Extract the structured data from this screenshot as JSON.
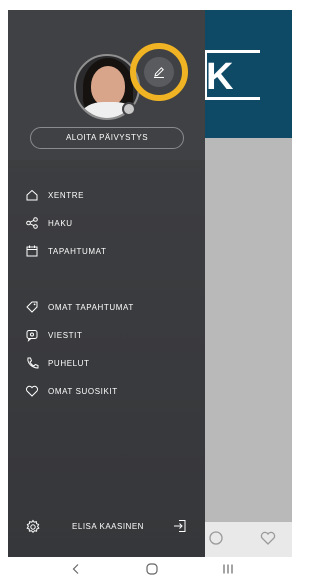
{
  "profile": {
    "shift_button_label": "ALOITA PÄIVYSTYS",
    "status": "offline"
  },
  "menu": {
    "primary": [
      {
        "label": "XENTRE",
        "icon": "home-icon"
      },
      {
        "label": "HAKU",
        "icon": "share-icon"
      },
      {
        "label": "TAPAHTUMAT",
        "icon": "calendar-icon"
      }
    ],
    "secondary": [
      {
        "label": "OMAT TAPAHTUMAT",
        "icon": "tag-icon"
      },
      {
        "label": "VIESTIT",
        "icon": "chat-icon"
      },
      {
        "label": "PUHELUT",
        "icon": "phone-icon"
      },
      {
        "label": "OMAT SUOSIKIT",
        "icon": "heart-icon"
      }
    ]
  },
  "footer": {
    "user_name": "ELISA KAASINEN"
  },
  "colors": {
    "drawer_bg": "#3f4043",
    "highlight": "#f0b323",
    "banner": "#0e4a66"
  },
  "system_nav": [
    "back",
    "home",
    "recents"
  ]
}
